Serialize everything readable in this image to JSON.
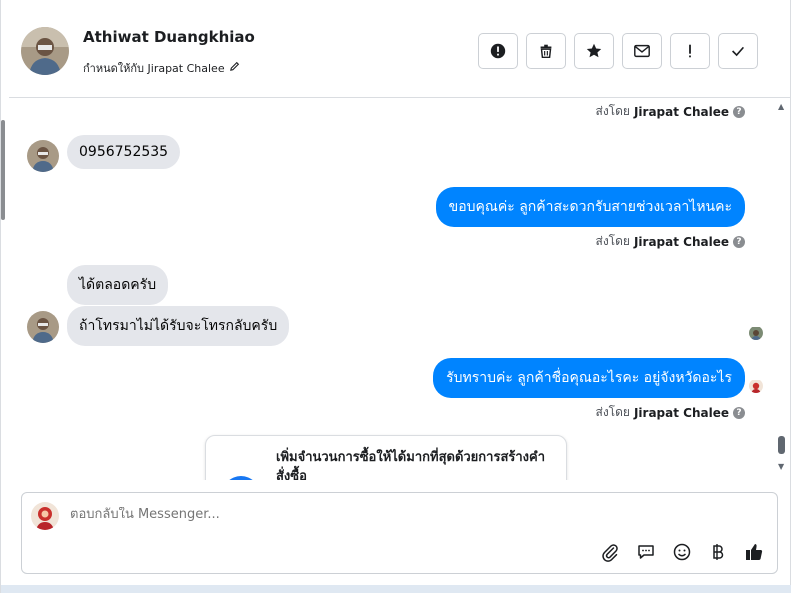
{
  "header": {
    "contact_name": "Athiwat Duangkhiao",
    "assigned_label": "กำหนดให้กับ Jirapat Chalee",
    "toolbar": [
      {
        "name": "report-spam-button",
        "icon": "exclamation-circle-icon"
      },
      {
        "name": "delete-button",
        "icon": "trash-icon"
      },
      {
        "name": "star-button",
        "icon": "star-icon"
      },
      {
        "name": "mark-unread-button",
        "icon": "envelope-icon"
      },
      {
        "name": "follow-up-button",
        "icon": "exclamation-icon"
      },
      {
        "name": "mark-done-button",
        "icon": "check-icon"
      }
    ]
  },
  "thread": {
    "sent_by_prefix": "ส่งโดย",
    "sent_by_name": "Jirapat Chalee",
    "help_glyph": "?",
    "messages": [
      {
        "direction": "in",
        "text": "0956752535"
      },
      {
        "direction": "out",
        "text": "ขอบคุณค่ะ ลูกค้าสะดวกรับสายช่วงเวลาไหนคะ"
      },
      {
        "direction": "in",
        "text": "ได้ตลอดครับ"
      },
      {
        "direction": "in",
        "text": "ถ้าโทรมาไม่ได้รับจะโทรกลับครับ"
      },
      {
        "direction": "out",
        "text": "รับทราบค่ะ ลูกค้าชื่อคุณอะไรคะ อยู่จังหวัดอะไร"
      }
    ],
    "card_text": "เพิ่มจำนวนการซื้อให้ได้มากที่สุดด้วยการสร้างคำสั่งซื้อ"
  },
  "composer": {
    "placeholder": "ตอบกลับใน Messenger...",
    "icons": [
      "attach-icon",
      "saved-replies-icon",
      "emoji-icon",
      "baht-icon",
      "like-icon"
    ]
  },
  "colors": {
    "accent": "#0084ff",
    "incoming_bubble": "#e4e6eb",
    "border": "#dadde1"
  }
}
